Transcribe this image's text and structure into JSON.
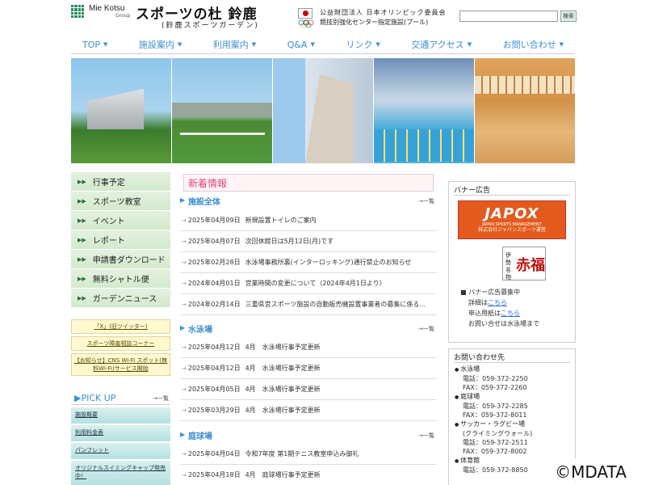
{
  "header": {
    "brand_top": "Mie Kotsu",
    "brand_group": "Group",
    "title": "スポーツの杜 鈴鹿",
    "subtitle": "(鈴鹿スポーツガーデン)",
    "jo_line1": "公益財団法人 日本オリンピック委員会",
    "jo_line2": "競技別強化センター指定施設(プール)",
    "search_button": "検索",
    "search_placeholder": ""
  },
  "nav": [
    {
      "label": "TOP"
    },
    {
      "label": "施設案内"
    },
    {
      "label": "利用案内"
    },
    {
      "label": "Q&A"
    },
    {
      "label": "リンク"
    },
    {
      "label": "交通アクセス"
    },
    {
      "label": "お問い合わせ"
    }
  ],
  "side_menu": [
    {
      "label": "行事予定"
    },
    {
      "label": "スポーツ教室"
    },
    {
      "label": "イベント"
    },
    {
      "label": "レポート"
    },
    {
      "label": "申請書ダウンロード"
    },
    {
      "label": "無料シャトル便"
    },
    {
      "label": "ガーデンニュース"
    }
  ],
  "side_banners": [
    {
      "label": "「X」(旧ツイッター)"
    },
    {
      "label": "スポーツ障害相談コーナー"
    },
    {
      "label": "【お知らせ】CNS Wi-Fi スポット(無料Wi-Fi)サービス開始"
    }
  ],
  "pickup": {
    "title": "PICK UP",
    "more": "一覧",
    "items": [
      {
        "label": "施設概要"
      },
      {
        "label": "利用料金表"
      },
      {
        "label": "パンフレット"
      },
      {
        "label": "オリジナルスイミングキャップ発売中！"
      }
    ]
  },
  "news": {
    "title": "新着情報",
    "more": "一覧",
    "sections": [
      {
        "label": "施設全体",
        "rows": [
          {
            "date": "2025年04月09日",
            "text": "新規設置トイレのご案内"
          },
          {
            "date": "2025年04月07日",
            "text": "次回休館日は5月12日(月)です"
          },
          {
            "date": "2025年02月28日",
            "text": "水泳場事務所裏(インターロッキング)通行禁止のお知らせ"
          },
          {
            "date": "2024年04月01日",
            "text": "営業時間の変更について（2024年4月1日より）"
          },
          {
            "date": "2024年02月14日",
            "text": "三重県営スポーツ施設の自動販売機設置事業者の募集に係る…"
          }
        ]
      },
      {
        "label": "水泳場",
        "rows": [
          {
            "date": "2025年04月12日",
            "text": "4月　水泳場行事予定更新"
          },
          {
            "date": "2025年04月12日",
            "text": "4月　水泳場行事予定更新"
          },
          {
            "date": "2025年04月05日",
            "text": "4月　水泳場行事予定更新"
          },
          {
            "date": "2025年03月29日",
            "text": "4月　水泳場行事予定更新"
          }
        ]
      },
      {
        "label": "庭球場",
        "rows": [
          {
            "date": "2025年04月04日",
            "text": "令和7年度 第1期テニス教室申込み御礼"
          },
          {
            "date": "2025年04月18日",
            "text": "4月　庭球場行事予定更新"
          }
        ]
      }
    ]
  },
  "banner_ad": {
    "title": "バナー広告",
    "japox_big": "JAPOX",
    "japox_small": "JAPAN SPORTS MANAGEMENT",
    "japox_jp": "株式会社ジャパンスポーツ運営",
    "akafuku_side": "伊勢名物",
    "akafuku_name": "赤福",
    "info_head": "■ バナー広告募集中",
    "info_detail_pre": "詳細は",
    "info_detail_link": "こちら",
    "info_form_pre": "申込用紙は",
    "info_form_link": "こちら",
    "info_contact": "お問い合せは水泳場まで"
  },
  "contact": {
    "title": "お問い合わせ先",
    "facilities": [
      {
        "name": "水泳場",
        "tel": "電話：059-372-2250",
        "fax": "FAX：059-372-2260"
      },
      {
        "name": "庭球場",
        "tel": "電話：059-372-2285",
        "fax": "FAX：059-372-8011"
      },
      {
        "name": "サッカー・ラグビー場",
        "sub": "(クライミングウォール)",
        "tel": "電話：059-372-2511",
        "fax": "FAX：059-372-8002"
      },
      {
        "name": "体育館",
        "tel": "電話：059-372-8850"
      }
    ]
  },
  "watermark": "©MDATA"
}
